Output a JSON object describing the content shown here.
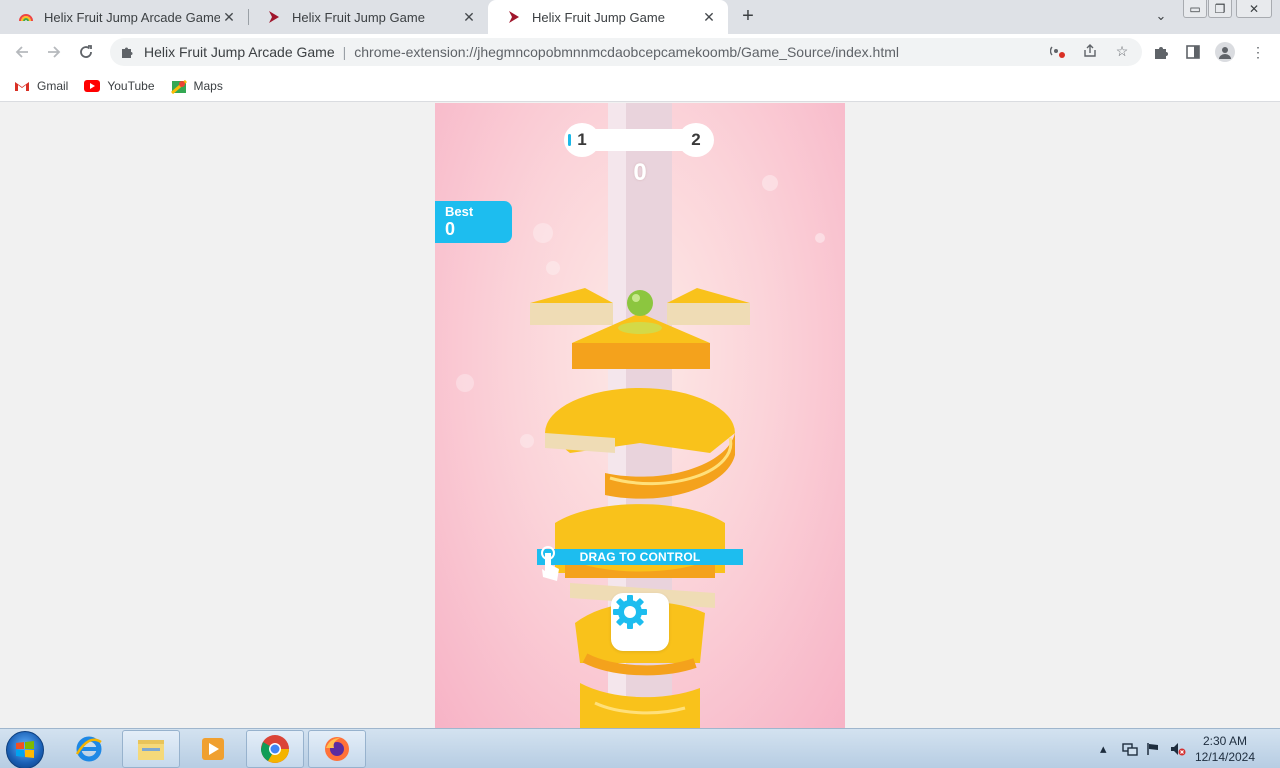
{
  "browser": {
    "tabs": [
      {
        "title": "Helix Fruit Jump Arcade Game - C",
        "favicon": "rainbow-icon",
        "active": false
      },
      {
        "title": "Helix Fruit Jump Game",
        "favicon": "play-arrow-icon",
        "active": false
      },
      {
        "title": "Helix Fruit Jump Game",
        "favicon": "play-arrow-icon",
        "active": true
      }
    ],
    "new_tab_label": "+",
    "omnibox": {
      "site_name": "Helix Fruit Jump Arcade Game",
      "separator": "|",
      "url": "chrome-extension://jhegmncopobmnnmcdaobcepcamekoomb/Game_Source/index.html"
    },
    "bookmarks": [
      {
        "label": "Gmail",
        "icon": "gmail-icon"
      },
      {
        "label": "YouTube",
        "icon": "youtube-icon"
      },
      {
        "label": "Maps",
        "icon": "maps-icon"
      }
    ]
  },
  "game": {
    "current_level": "1",
    "next_level": "2",
    "level_progress": 0,
    "score": "0",
    "best_label": "Best",
    "best_value": "0",
    "hint": "DRAG TO CONTROL",
    "settings_icon": "gear-icon",
    "colors": {
      "accent": "#1dbdef",
      "orange": "#f7b21a",
      "pink": "#f7b3c6",
      "ball": "#8cc63f"
    }
  },
  "taskbar": {
    "apps": [
      "windows-start",
      "internet-explorer",
      "file-explorer",
      "media-player",
      "chrome",
      "firefox"
    ],
    "clock_time": "2:30 AM",
    "clock_date": "12/14/2024"
  }
}
